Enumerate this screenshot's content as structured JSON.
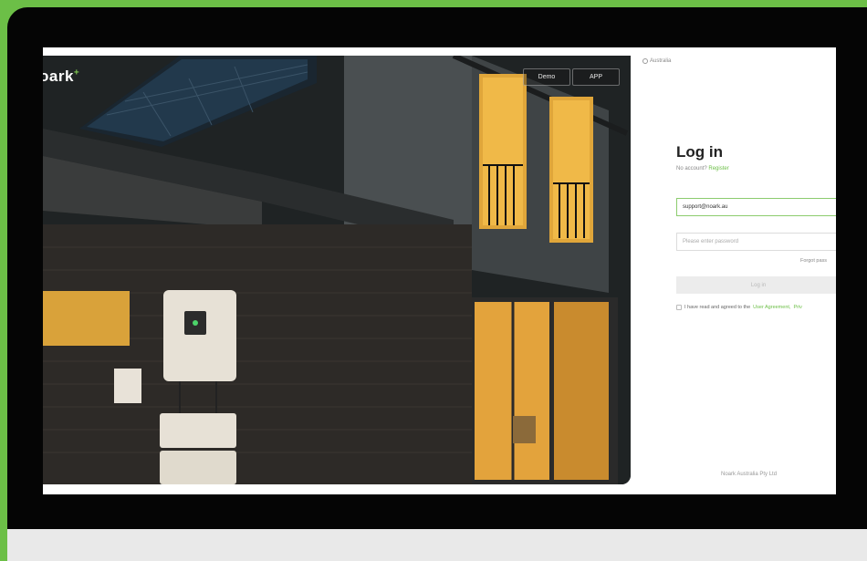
{
  "app": {
    "brand_text": "oark",
    "brand_mark": "+"
  },
  "hero": {
    "demo_label": "Demo",
    "app_label": "APP"
  },
  "region": {
    "icon": "globe-icon",
    "label": "Australia"
  },
  "login": {
    "title": "Log in",
    "no_account_text": "No account?",
    "register_link": "Register",
    "email_value": "support@noark.au",
    "password_placeholder": "Please enter password",
    "forgot_label": "Forgot pass",
    "submit_label": "Log in",
    "agree_text": "I have read and agreed to the",
    "user_agreement_link": "User Agreement,",
    "privacy_link": "Priv"
  },
  "footer": {
    "company": "Noark Australia Pty Ltd"
  },
  "colors": {
    "accent": "#6cbf47",
    "frame": "#050505",
    "window_glow": "#e0a63a"
  }
}
